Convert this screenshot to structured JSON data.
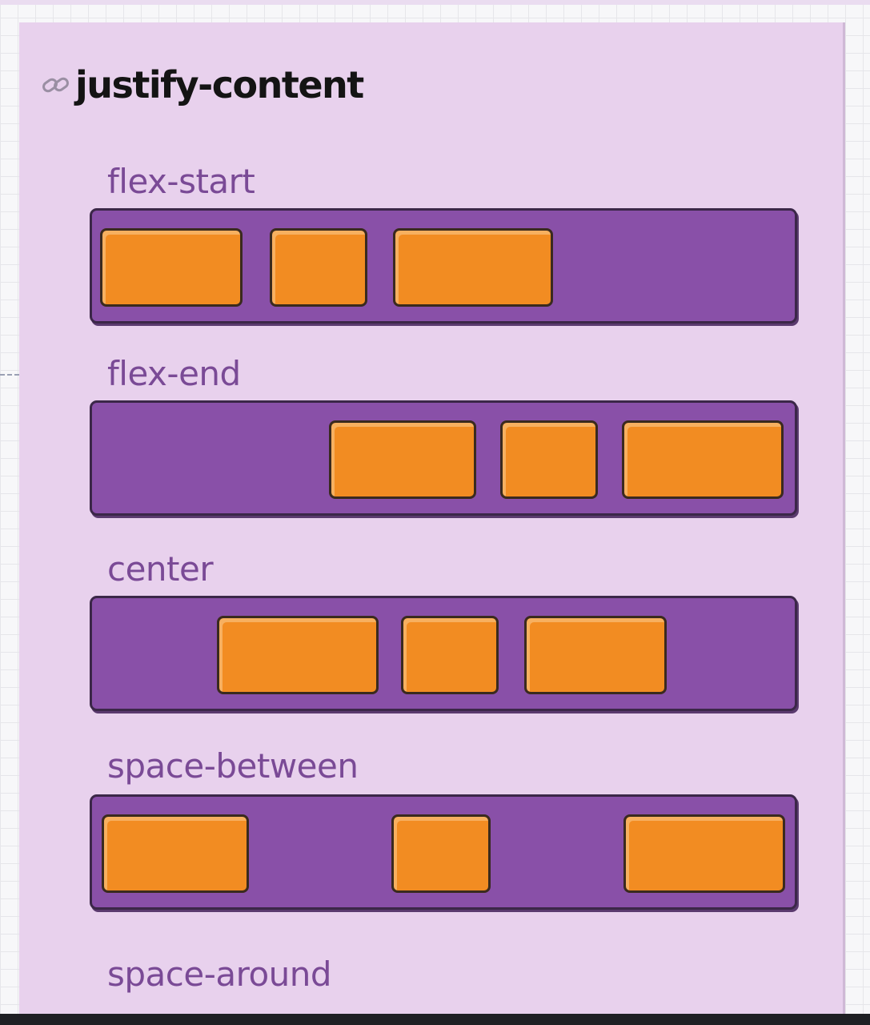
{
  "title": "justify-content",
  "icons": {
    "title_icon": "link-icon"
  },
  "colors": {
    "card_background": "#e8d1ed",
    "container_fill": "#8950a8",
    "container_border": "#3b2748",
    "item_fill": "#f28c22",
    "label_color": "#7a4a96",
    "title_color": "#141414"
  },
  "examples": [
    {
      "label": "flex-start"
    },
    {
      "label": "flex-end"
    },
    {
      "label": "center"
    },
    {
      "label": "space-between"
    },
    {
      "label": "space-around"
    }
  ]
}
